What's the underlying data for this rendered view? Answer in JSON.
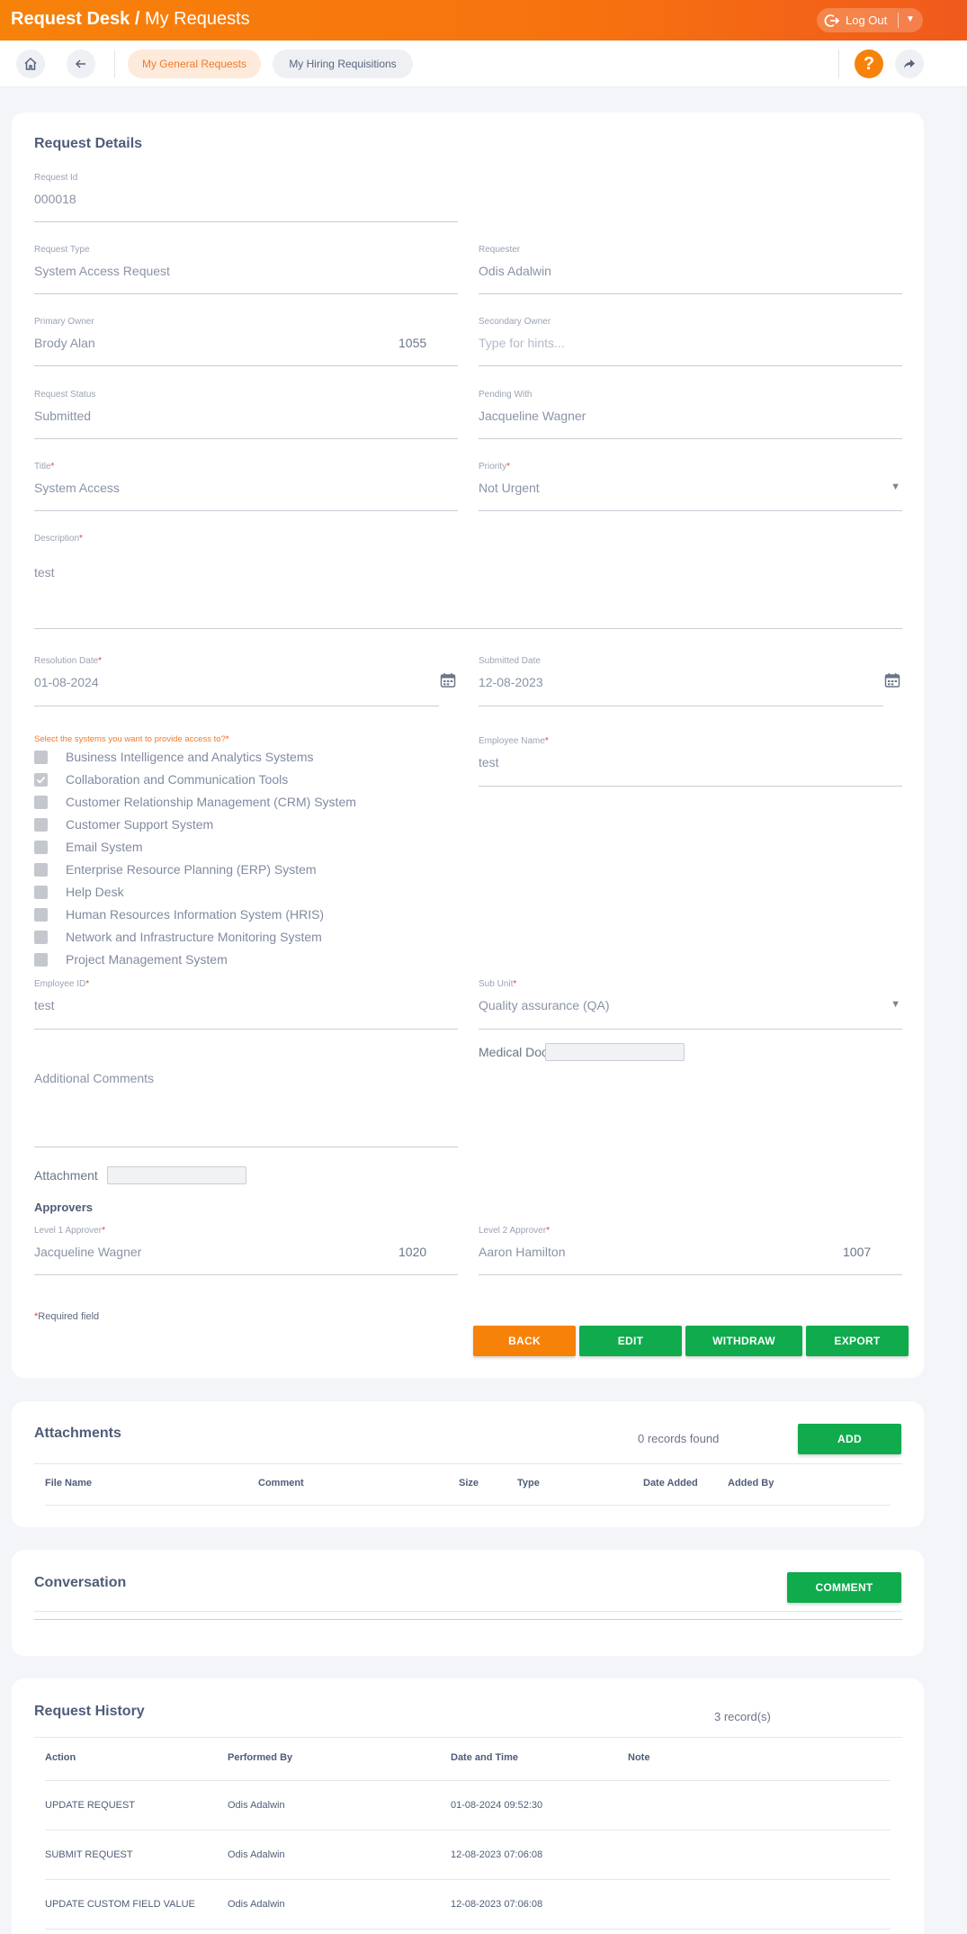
{
  "header": {
    "app_name": "Request Desk",
    "separator": "/",
    "section": "My Requests",
    "logout_label": "Log Out"
  },
  "nav": {
    "tabs": [
      "My General Requests",
      "My Hiring Requisitions"
    ],
    "active_tab": "My General Requests",
    "help_label": "?"
  },
  "details": {
    "title": "Request Details",
    "fields": {
      "request_id": {
        "label": "Request Id",
        "value": "000018"
      },
      "request_type": {
        "label": "Request Type",
        "value": "System Access Request"
      },
      "requester": {
        "label": "Requester",
        "value": "Odis Adalwin"
      },
      "primary_owner": {
        "label": "Primary Owner",
        "value": "Brody Alan",
        "extra": "1055"
      },
      "secondary_owner": {
        "label": "Secondary Owner",
        "placeholder": "Type for hints..."
      },
      "request_status": {
        "label": "Request Status",
        "value": "Submitted"
      },
      "pending_with": {
        "label": "Pending With",
        "value": "Jacqueline Wagner"
      },
      "title": {
        "label": "Title",
        "value": "System Access"
      },
      "priority": {
        "label": "Priority",
        "value": "Not Urgent"
      },
      "description": {
        "label": "Description",
        "value": "test"
      },
      "resolution_date": {
        "label": "Resolution Date",
        "value": "01-08-2024"
      },
      "submitted_date": {
        "label": "Submitted Date",
        "value": "12-08-2023"
      },
      "employee_name": {
        "label": "Employee Name",
        "value": "test"
      },
      "employee_id": {
        "label": "Employee ID",
        "value": "test"
      },
      "sub_unit": {
        "label": "Sub Unit",
        "value": "Quality assurance (QA)"
      }
    },
    "systems_label": "Select the systems you want to provide access to?",
    "systems": [
      {
        "label": "Business Intelligence and Analytics Systems",
        "checked": false
      },
      {
        "label": "Collaboration and Communication Tools",
        "checked": true
      },
      {
        "label": "Customer Relationship Management (CRM) System",
        "checked": false
      },
      {
        "label": "Customer Support System",
        "checked": false
      },
      {
        "label": "Email System",
        "checked": false
      },
      {
        "label": "Enterprise Resource Planning (ERP) System",
        "checked": false
      },
      {
        "label": "Help Desk",
        "checked": false
      },
      {
        "label": "Human Resources Information System (HRIS)",
        "checked": false
      },
      {
        "label": "Network and Infrastructure Monitoring System",
        "checked": false
      },
      {
        "label": "Project Management System",
        "checked": false
      }
    ],
    "medical_doc_label": "Medical Doc",
    "additional_comments_placeholder": "Additional Comments",
    "attachment_label": "Attachment",
    "approvers_title": "Approvers",
    "level1": {
      "label": "Level 1 Approver",
      "value": "Jacqueline Wagner",
      "extra": "1020"
    },
    "level2": {
      "label": "Level 2 Approver",
      "value": "Aaron Hamilton",
      "extra": "1007"
    },
    "required_note": "Required field",
    "buttons": {
      "back": "BACK",
      "edit": "EDIT",
      "withdraw": "WITHDRAW",
      "export": "EXPORT"
    }
  },
  "attachments": {
    "title": "Attachments",
    "records": "0 records found",
    "add_label": "ADD",
    "columns": [
      "File Name",
      "Comment",
      "Size",
      "Type",
      "Date Added",
      "Added By"
    ]
  },
  "conversation": {
    "title": "Conversation",
    "comment_label": "COMMENT"
  },
  "history": {
    "title": "Request History",
    "records": "3 record(s)",
    "columns": [
      "Action",
      "Performed By",
      "Date and Time",
      "Note"
    ],
    "rows": [
      {
        "action": "UPDATE REQUEST",
        "by": "Odis Adalwin",
        "datetime": "01-08-2024 09:52:30",
        "note": ""
      },
      {
        "action": "SUBMIT REQUEST",
        "by": "Odis Adalwin",
        "datetime": "12-08-2023 07:06:08",
        "note": ""
      },
      {
        "action": "UPDATE CUSTOM FIELD VALUE",
        "by": "Odis Adalwin",
        "datetime": "12-08-2023 07:06:08",
        "note": ""
      }
    ]
  },
  "colors": {
    "accent": "#f7820a",
    "success": "#0fab4d",
    "required": "#e8433a"
  }
}
